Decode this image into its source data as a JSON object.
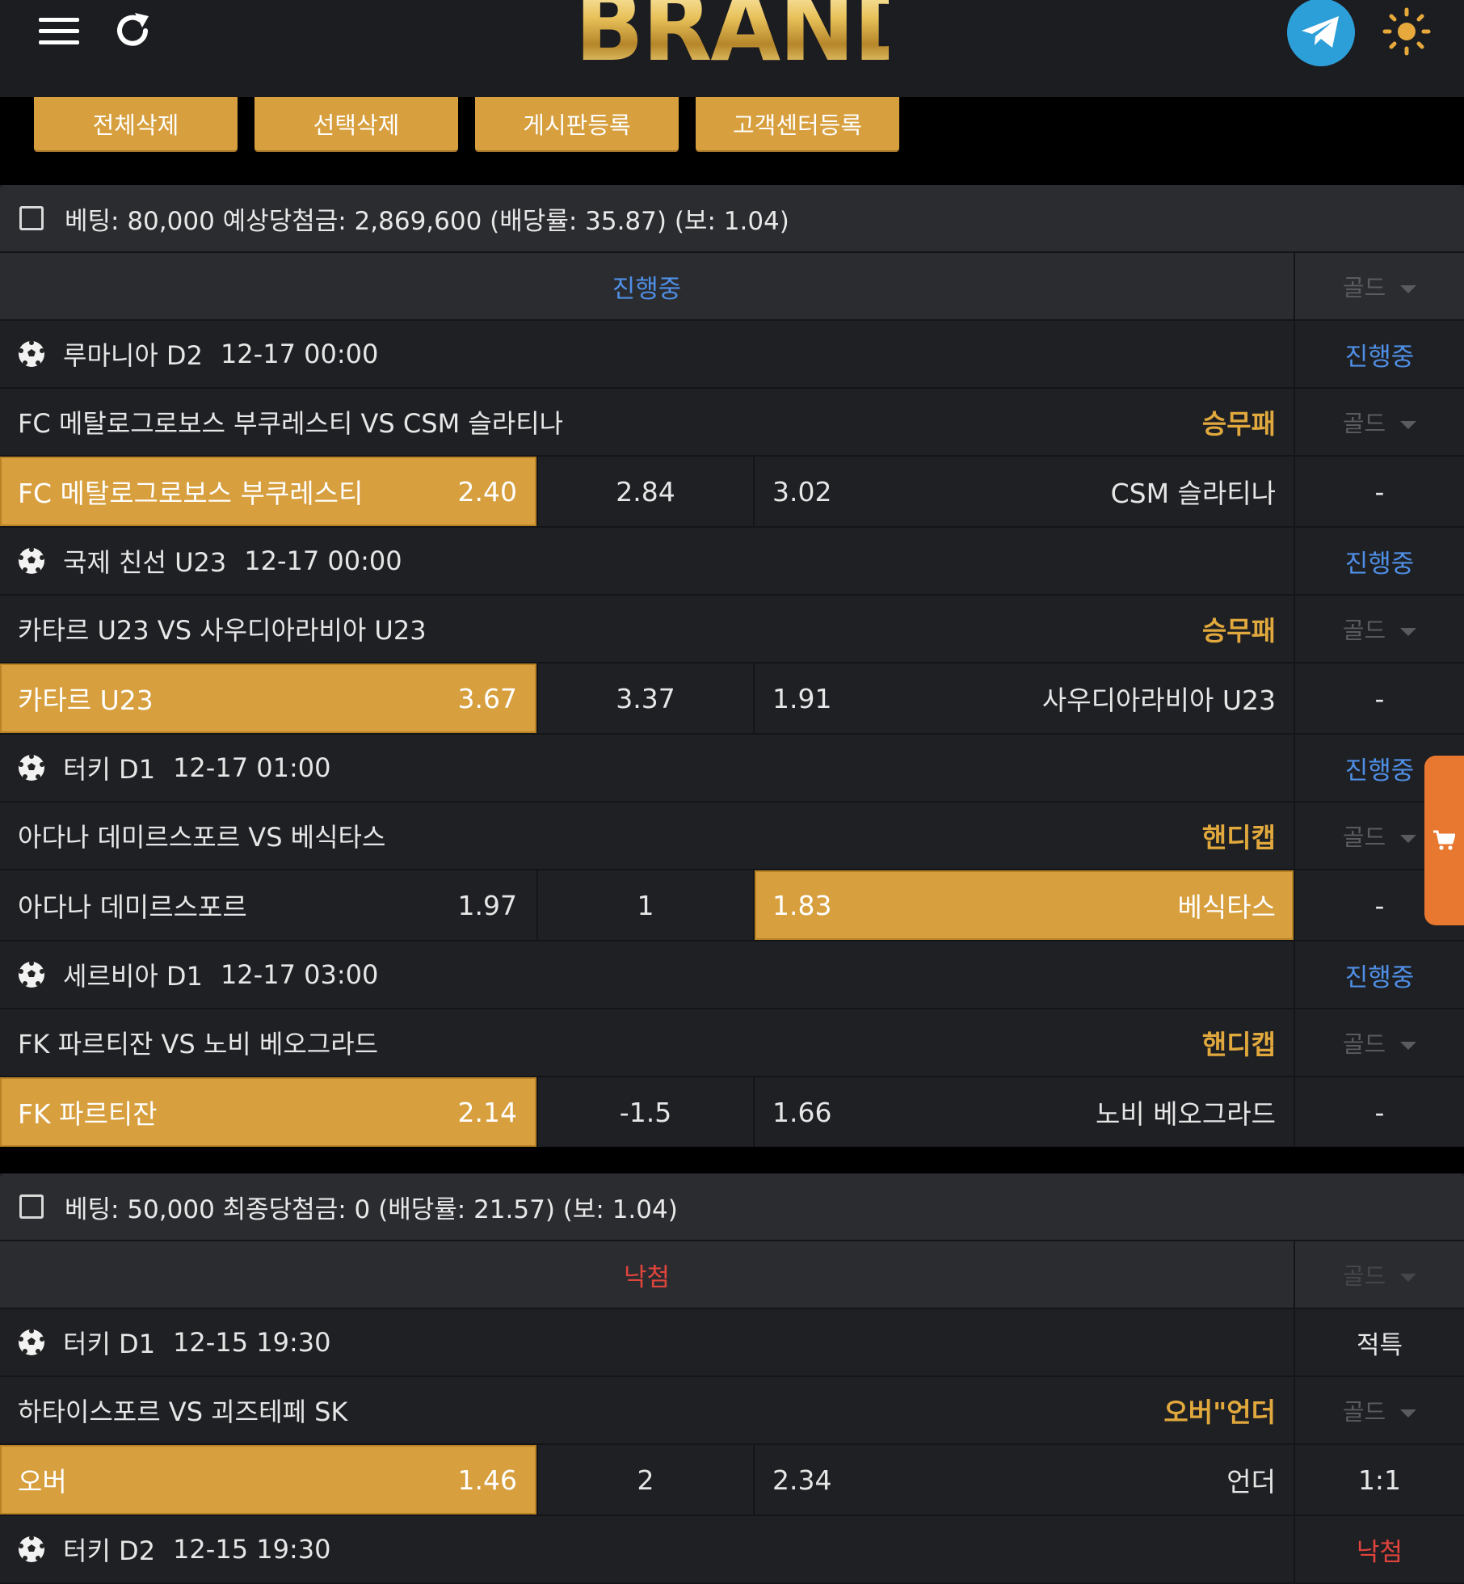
{
  "header": {
    "brand": "BRAND",
    "menu_icon": "hamburger-menu-icon",
    "refresh_icon": "refresh-icon",
    "telegram_icon": "telegram-icon",
    "theme_icon": "sun-icon"
  },
  "actions": [
    "전체삭제",
    "선택삭제",
    "게시판등록",
    "고객센터등록"
  ],
  "gold_label": "골드",
  "bets": [
    {
      "summary": "베팅: 80,000 예상당첨금: 2,869,600 (배당률: 35.87) (보: 1.04)",
      "status": "진행중",
      "games": [
        {
          "league": "루마니아 D2",
          "time": "12-17 00:00",
          "game_status": "진행중",
          "match": "FC 메탈로그로보스 부쿠레스티 VS CSM 슬라티나",
          "market": "승무패",
          "home": "FC 메탈로그로보스 부쿠레스티",
          "home_odds": "2.40",
          "mid": "2.84",
          "away_odds": "3.02",
          "away": "CSM 슬라티나",
          "result": "-",
          "selected": "home"
        },
        {
          "league": "국제 친선 U23",
          "time": "12-17 00:00",
          "game_status": "진행중",
          "match": "카타르 U23 VS 사우디아라비아 U23",
          "market": "승무패",
          "home": "카타르 U23",
          "home_odds": "3.67",
          "mid": "3.37",
          "away_odds": "1.91",
          "away": "사우디아라비아 U23",
          "result": "-",
          "selected": "home"
        },
        {
          "league": "터키 D1",
          "time": "12-17 01:00",
          "game_status": "진행중",
          "match": "아다나 데미르스포르 VS 베식타스",
          "market": "핸디캡",
          "home": "아다나 데미르스포르",
          "home_odds": "1.97",
          "mid": "1",
          "away_odds": "1.83",
          "away": "베식타스",
          "result": "-",
          "selected": "away"
        },
        {
          "league": "세르비아 D1",
          "time": "12-17 03:00",
          "game_status": "진행중",
          "match": "FK 파르티잔 VS 노비 베오그라드",
          "market": "핸디캡",
          "home": "FK 파르티잔",
          "home_odds": "2.14",
          "mid": "-1.5",
          "away_odds": "1.66",
          "away": "노비 베오그라드",
          "result": "-",
          "selected": "home"
        }
      ]
    },
    {
      "summary": "베팅: 50,000 최종당첨금: 0 (배당률: 21.57) (보: 1.04)",
      "status": "낙첨",
      "games": [
        {
          "league": "터키 D1",
          "time": "12-15 19:30",
          "game_status": "적특",
          "match": "하타이스포르 VS 괴즈테페 SK",
          "market": "오버\"언더",
          "home": "오버",
          "home_odds": "1.46",
          "mid": "2",
          "away_odds": "2.34",
          "away": "언더",
          "result": "1:1",
          "selected": "home"
        },
        {
          "league": "터키 D2",
          "time": "12-15 19:30",
          "game_status": "낙첨"
        }
      ]
    }
  ],
  "colors": {
    "accent": "#d79f3e",
    "status_live": "#4f8fe6",
    "status_lost": "#e0443c",
    "market": "#e1a93d",
    "cart": "#e8772f"
  },
  "cart_icon": "cart-icon"
}
